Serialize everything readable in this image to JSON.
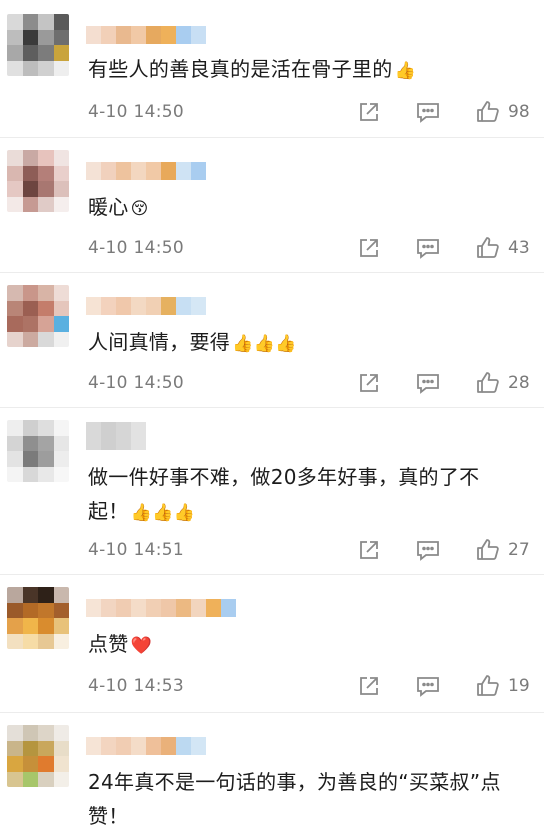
{
  "colors": {
    "text": "#1c1c1c",
    "meta": "#7a7a7a",
    "divider": "#ececec",
    "icon": "#8a8a8a"
  },
  "comments": [
    {
      "text": "有些人的善良真的是活在骨子里的",
      "emoji": "👍",
      "time": "4-10 14:50",
      "likes": "98",
      "avatar_palette": [
        "#d9d9d9",
        "#8c8c8c",
        "#c4c4c4",
        "#5a5a5a",
        "#bdbdbd",
        "#3b3b3b",
        "#9a9a9a",
        "#6e6e6e",
        "#a8a8a8",
        "#5e5e5e",
        "#7c7c7c",
        "#c9a43c",
        "#e0e0e0",
        "#bdbdbd",
        "#d0d0d0",
        "#eeeeee"
      ],
      "name_palette": [
        "#f4ded0",
        "#f2d0b8",
        "#e9b98f",
        "#f1c9a6",
        "#e6a95f",
        "#efb15a",
        "#a9cdf0",
        "#c8dff4"
      ]
    },
    {
      "text": "暖心",
      "emoji": "😚",
      "time": "4-10 14:50",
      "likes": "43",
      "avatar_palette": [
        "#eadcd8",
        "#c9a9a4",
        "#e7c3bd",
        "#f0e4e2",
        "#d9b7b0",
        "#8e5d57",
        "#b47f79",
        "#e9cfcb",
        "#e5c8c3",
        "#6d4540",
        "#a87771",
        "#dcc0bb",
        "#f3e9e7",
        "#c69a93",
        "#e0cbc7",
        "#f5eeed"
      ],
      "name_palette": [
        "#f4e2d6",
        "#f1d1bd",
        "#eec39e",
        "#f3d7c0",
        "#f1c9a6",
        "#e8a95a",
        "#cfe3f4",
        "#a9cdf0"
      ]
    },
    {
      "text": "人间真情，要得",
      "emoji": "👍👍👍",
      "time": "4-10 14:50",
      "likes": "28",
      "avatar_palette": [
        "#d6b9b0",
        "#c9968a",
        "#d8b4a6",
        "#eedcd6",
        "#b98577",
        "#9b5f52",
        "#c47d6b",
        "#e5c6bc",
        "#a86a5c",
        "#ad7365",
        "#d6a396",
        "#5ab0e0",
        "#e6d3cd",
        "#ccaaa0",
        "#d9d9d9",
        "#f0f0f0"
      ],
      "name_palette": [
        "#f6e3d4",
        "#f3d2bd",
        "#f0c8ab",
        "#f3d9c3",
        "#f1d0b4",
        "#e6b160",
        "#c7dff3",
        "#d5e7f5"
      ]
    },
    {
      "text": "做一件好事不难，做20多年好事，真的了不起！",
      "emoji": "👍👍👍",
      "time": "4-10 14:51",
      "likes": "27",
      "avatar_palette": [
        "#eeeeee",
        "#cfcfcf",
        "#dedede",
        "#f5f5f5",
        "#d4d4d4",
        "#8f8f8f",
        "#a4a4a4",
        "#e6e6e6",
        "#e3e3e3",
        "#7b7b7b",
        "#9d9d9d",
        "#ededed",
        "#f4f4f4",
        "#d8d8d8",
        "#e8e8e8",
        "#f7f7f7"
      ],
      "name_palette": [
        "#d9d9d9",
        "#cfcfcf",
        "#d6d6d6",
        "#e2e2e2"
      ]
    },
    {
      "text": "点赞",
      "emoji": "❤️",
      "time": "4-10 14:53",
      "likes": "19",
      "avatar_palette": [
        "#b9a79d",
        "#4a3528",
        "#2e2118",
        "#c9b8ad",
        "#9a5a2a",
        "#b36a26",
        "#c1772b",
        "#a35f2c",
        "#e4a14a",
        "#f0b54a",
        "#d98c2e",
        "#e8c27a",
        "#f3e0c0",
        "#f6dca6",
        "#e7c894",
        "#f8efe0"
      ],
      "name_palette": [
        "#f6e4d6",
        "#f2d5c1",
        "#f0ccb2",
        "#f4dcc8",
        "#f1cfb4",
        "#efc7a8",
        "#ecb982",
        "#f2d5be",
        "#efb15a",
        "#a9cdf0"
      ]
    },
    {
      "text": "24年真不是一句话的事，为善良的“买菜叔”点赞！",
      "emoji": "",
      "time": "",
      "likes": "",
      "avatar_palette": [
        "#e4dfd8",
        "#cfc6b5",
        "#ddd5c8",
        "#efebe6",
        "#c9b58a",
        "#b5953f",
        "#c9a75c",
        "#e8ddc8",
        "#d9a640",
        "#c6903a",
        "#e07b2e",
        "#f0e3cf",
        "#d8c590",
        "#a7c66a",
        "#d9d0bf",
        "#f3efe8"
      ],
      "name_palette": [
        "#f6e4d6",
        "#f3d5c0",
        "#f1cdb3",
        "#f4dcc8",
        "#efc09a",
        "#eab17a",
        "#bcd9f1",
        "#d3e6f5"
      ]
    }
  ]
}
